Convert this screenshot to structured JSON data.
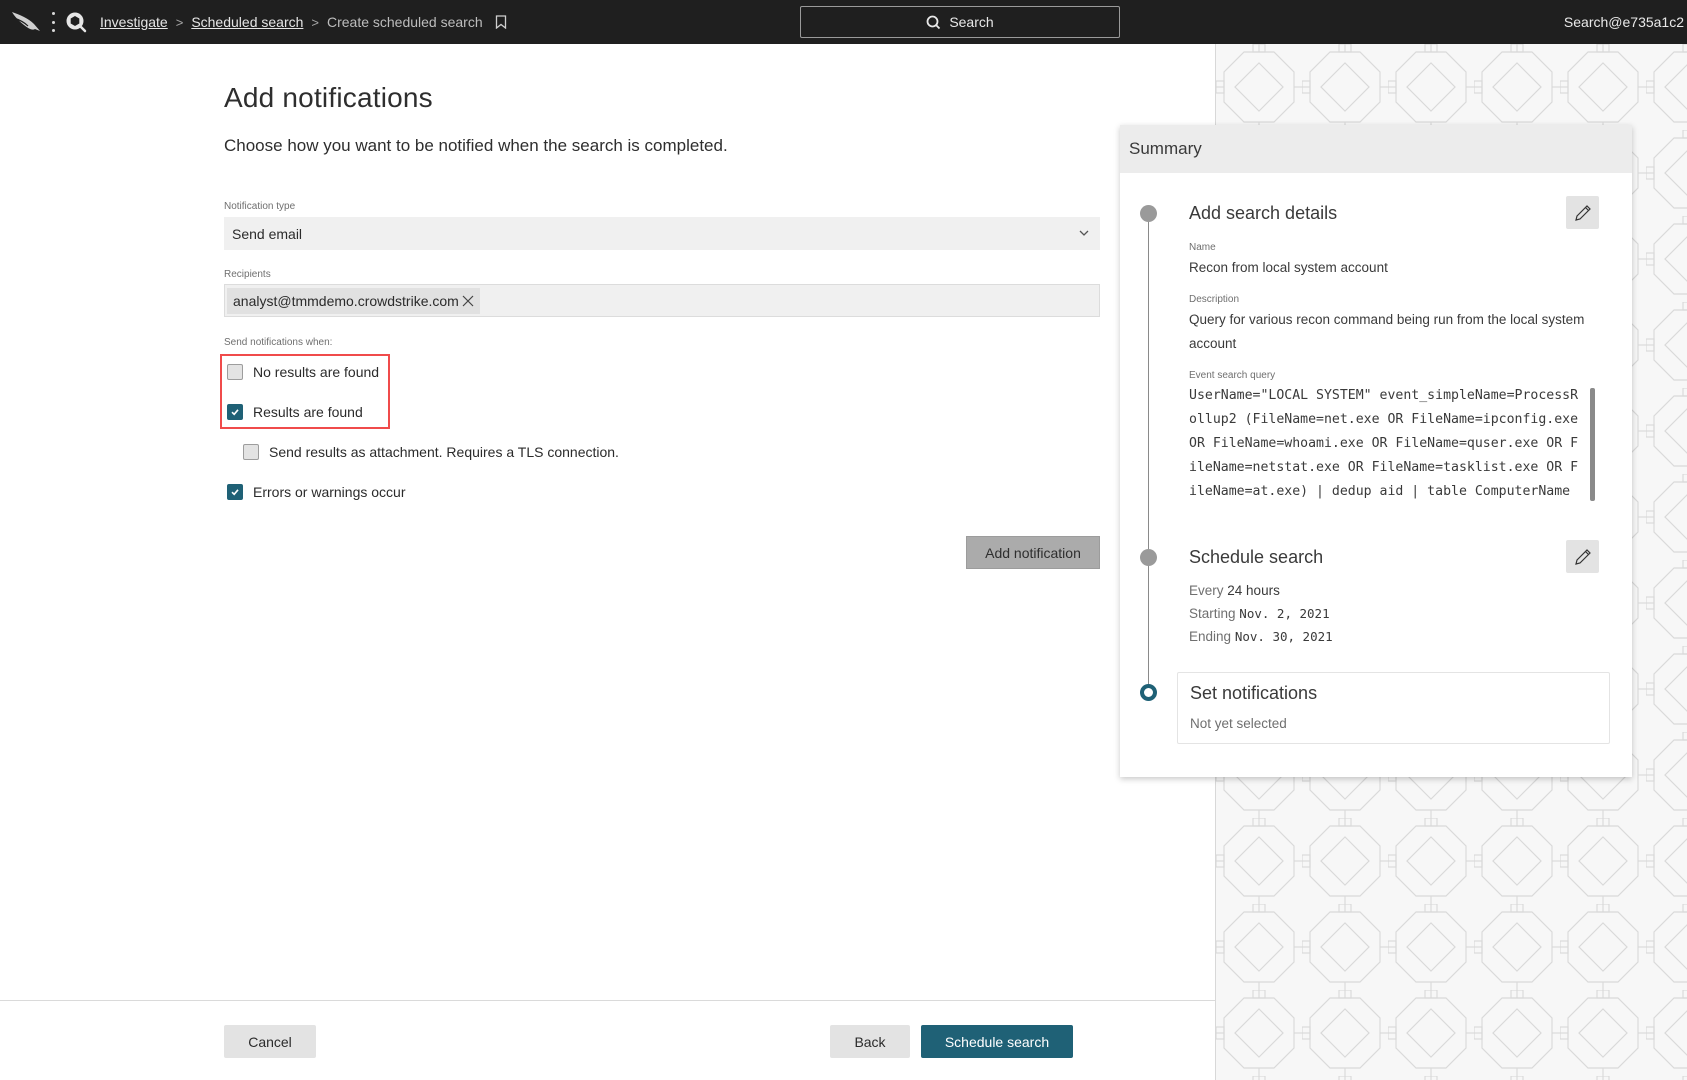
{
  "topbar": {
    "breadcrumbs": [
      {
        "label": "Investigate",
        "link": true
      },
      {
        "label": "Scheduled search",
        "link": true
      },
      {
        "label": "Create scheduled search",
        "link": false
      }
    ],
    "search_label": "Search",
    "user_label": "Search@e735a1c2"
  },
  "form": {
    "title": "Add notifications",
    "subtitle": "Choose how you want to be notified when the search is completed.",
    "notification_type_label": "Notification type",
    "notification_type_value": "Send email",
    "recipients_label": "Recipients",
    "recipients": [
      "analyst@tmmdemo.crowdstrike.com"
    ],
    "send_when_label": "Send notifications when:",
    "options": [
      {
        "label": "No results are found",
        "checked": false
      },
      {
        "label": "Results are found",
        "checked": true
      },
      {
        "label": "Send results as attachment. Requires a TLS connection.",
        "checked": false
      },
      {
        "label": "Errors or warnings occur",
        "checked": true
      }
    ],
    "add_notification_label": "Add notification"
  },
  "footer": {
    "cancel_label": "Cancel",
    "back_label": "Back",
    "schedule_label": "Schedule search"
  },
  "summary": {
    "title": "Summary",
    "step1": {
      "title": "Add search details",
      "name_label": "Name",
      "name_value": "Recon from local system account",
      "description_label": "Description",
      "description_value": "Query for various recon command being run from the local system account",
      "query_label": "Event search query",
      "query_value": "UserName=\"LOCAL SYSTEM\" event_simpleName=ProcessRollup2 (FileName=net.exe OR FileName=ipconfig.exe OR FileName=whoami.exe OR FileName=quser.exe OR FileName=netstat.exe OR FileName=tasklist.exe OR FileName=at.exe) | dedup aid | table ComputerName UserName FileName CommandLine"
    },
    "step2": {
      "title": "Schedule search",
      "every_prefix": "Every",
      "every_value": "24 hours",
      "starting_prefix": "Starting",
      "starting_value": "Nov. 2, 2021",
      "ending_prefix": "Ending",
      "ending_value": "Nov. 30, 2021"
    },
    "step3": {
      "title": "Set notifications",
      "status": "Not yet selected"
    }
  },
  "colors": {
    "accent": "#1f6176",
    "highlight": "#f04b4b",
    "topbar": "#1f1f1f"
  }
}
